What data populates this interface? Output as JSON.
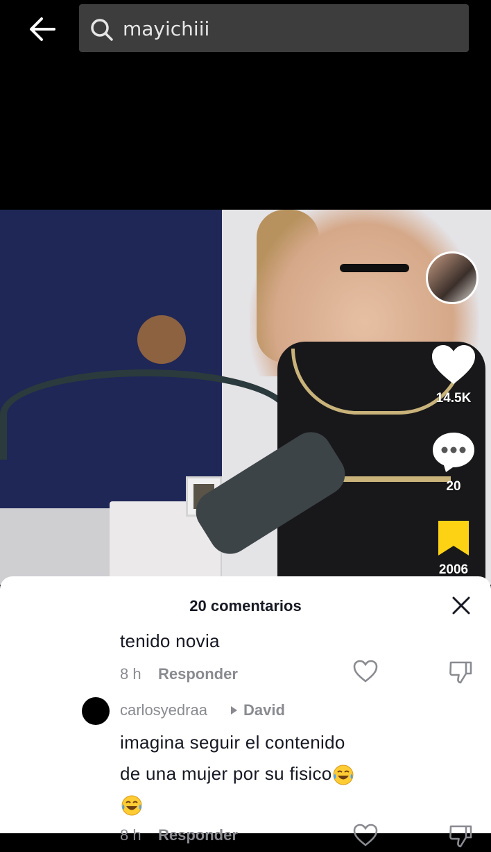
{
  "search": {
    "query": "mayichiii"
  },
  "video_actions": {
    "likes": "14.5K",
    "comments": "20",
    "saves": "2006"
  },
  "comments_sheet": {
    "title": "20 comentarios",
    "comments": [
      {
        "text_fragment": "tenido novia",
        "time": "8 h",
        "reply_label": "Responder"
      },
      {
        "username": "carlosyedraa",
        "reply_to": "David",
        "text_line1": "imagina seguir el contenido",
        "text_line2": "de una mujer por su fisico",
        "emoji": "face-with-tears-of-joy",
        "time": "8 h",
        "reply_label": "Responder"
      }
    ]
  },
  "colors": {
    "search_bg": "#3d3d3d",
    "save_yellow": "#fdd215",
    "sheet_bg": "#ffffff",
    "muted_text": "#8a8b91"
  }
}
